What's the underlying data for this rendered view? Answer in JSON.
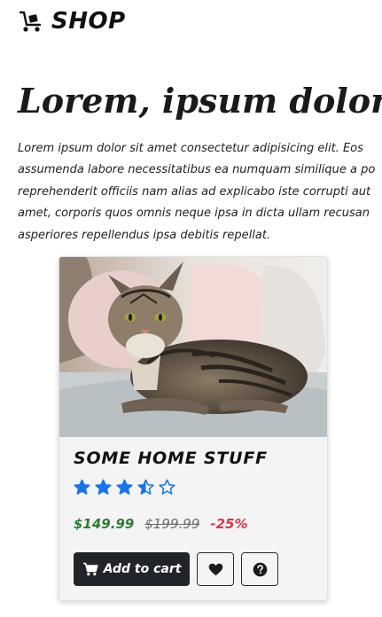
{
  "brand": {
    "icon": "hand-truck-icon",
    "name": "SHOP"
  },
  "hero": {
    "title": "Lorem, ipsum dolor sit a",
    "lines": [
      "Lorem ipsum dolor sit amet consectetur adipisicing elit. Eos",
      "assumenda labore necessitatibus ea numquam similique a po",
      "reprehenderit officiis nam alias ad explicabo iste corrupti aut",
      "amet, corporis quos omnis neque ipsa in dicta ullam recusan",
      "asperiores repellendus ipsa debitis repellat."
    ]
  },
  "product": {
    "image": "cat-photo",
    "title": "SOME HOME STUFF",
    "rating": 3.5,
    "rating_max": 5,
    "price": "$149.99",
    "old_price": "$199.99",
    "discount": "-25%",
    "add_to_cart_label": "Add to cart",
    "add_to_cart_icon": "cart-icon",
    "wishlist_icon": "heart-icon",
    "info_icon": "question-circle-icon"
  },
  "colors": {
    "star": "#1a73e8",
    "price": "#2e7d32",
    "discount": "#dc3545",
    "button_dark": "#212529"
  }
}
